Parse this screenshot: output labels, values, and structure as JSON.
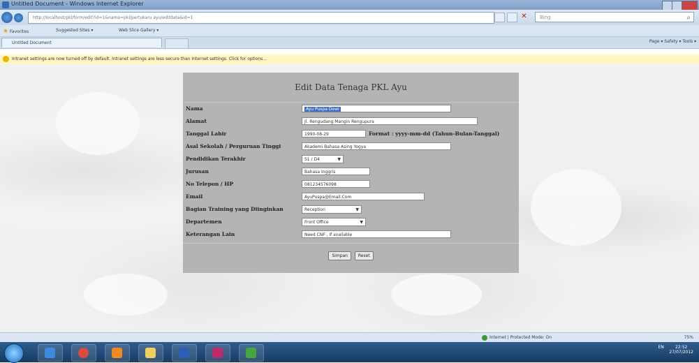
{
  "window": {
    "title": "Untitled Document - Windows Internet Explorer"
  },
  "address_bar": {
    "url": "http://localhost/pkl/form/edit?id=1&nama=pkl/pertukaru ayu/editdata&id=1",
    "search_placeholder": "Bing"
  },
  "favorites_bar": {
    "favorites_label": "Favorites",
    "suggested_sites": "Suggested Sites ▾",
    "web_slice_gallery": "Web Slice Gallery ▾"
  },
  "tabs": [
    {
      "label": "Untitled Document"
    }
  ],
  "command_bar": {
    "text": "Page ▾  Safety ▾  Tools ▾"
  },
  "info_bar": {
    "message": "Intranet settings are now turned off by default. Intranet settings are less secure than Internet settings. Click for options..."
  },
  "form": {
    "title": "Edit Data Tenaga PKL Ayu",
    "fields": [
      {
        "label": "Nama",
        "value": "Ayu Puspa Dewi",
        "selected": true
      },
      {
        "label": "Alamat",
        "value": "Jl. Rengudang Mangin Rengupura"
      },
      {
        "label": "Tanggal Lahir",
        "value": "1990-08-29",
        "hint": "Format : yyyy-mm-dd (Tahun-Bulan-Tanggal)"
      },
      {
        "label": "Asal Sekolah / Perguruan Tinggi",
        "value": "Akademi Bahasa Asing Yogya"
      },
      {
        "label": "Pendidikan Terakhir",
        "value": "S1 / D4",
        "type": "select"
      },
      {
        "label": "Jurusan",
        "value": "Bahasa Inggris"
      },
      {
        "label": "No Telepon / HP",
        "value": "081234576098"
      },
      {
        "label": "Email",
        "value": "AyuPuspa@Email.Com"
      },
      {
        "label": "Bagian Training yang Diinginkan",
        "value": "Reception",
        "type": "select"
      },
      {
        "label": "Departemen",
        "value": "Front Office",
        "type": "select"
      },
      {
        "label": "Keterangan Lain",
        "value": "Need CNF , if available"
      }
    ],
    "buttons": {
      "save": "Simpan",
      "reset": "Reset"
    }
  },
  "status_bar": {
    "zone": "Internet | Protected Mode: On",
    "zoom": "75%"
  },
  "taskbar": {
    "language": "EN",
    "time": "22:52",
    "date": "27/07/2012"
  }
}
